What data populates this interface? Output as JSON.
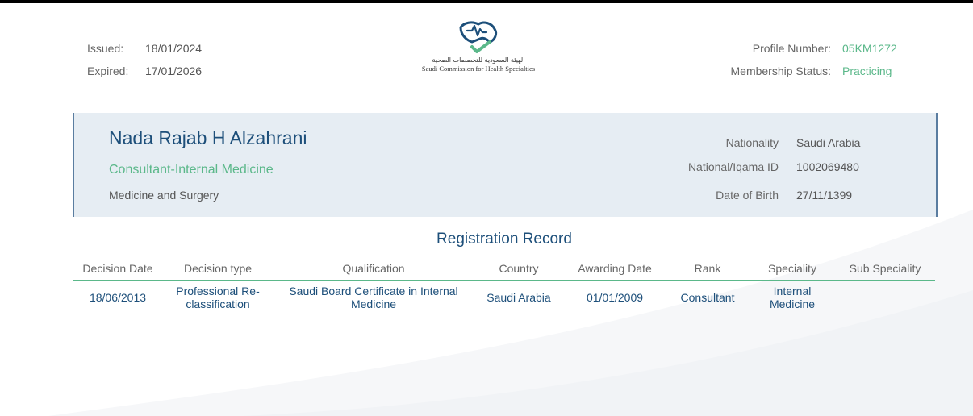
{
  "header": {
    "issued_label": "Issued:",
    "issued_value": "18/01/2024",
    "expired_label": "Expired:",
    "expired_value": "17/01/2026",
    "logo_text_ar": "الهيئة السعودية للتخصصات الصحية",
    "logo_text_en": "Saudi Commission for Health Specialties",
    "profile_number_label": "Profile Number:",
    "profile_number_value": "05KM1272",
    "membership_status_label": "Membership Status:",
    "membership_status_value": "Practicing"
  },
  "profile": {
    "name": "Nada Rajab H Alzahrani",
    "specialty": "Consultant-Internal Medicine",
    "field": "Medicine and Surgery",
    "nationality_label": "Nationality",
    "nationality_value": "Saudi Arabia",
    "national_id_label": "National/Iqama ID",
    "national_id_value": "1002069480",
    "dob_label": "Date of Birth",
    "dob_value": "27/11/1399"
  },
  "registration": {
    "title": "Registration Record",
    "columns": [
      "Decision Date",
      "Decision type",
      "Qualification",
      "Country",
      "Awarding Date",
      "Rank",
      "Speciality",
      "Sub Speciality"
    ],
    "rows": [
      [
        "18/06/2013",
        "Professional Re-classification",
        "Saudi Board Certificate in Internal Medicine",
        "Saudi Arabia",
        "01/01/2009",
        "Consultant",
        "Internal Medicine",
        ""
      ]
    ]
  },
  "colors": {
    "navy": "#1d4f7a",
    "green": "#5bb88a",
    "panel_bg": "#e6edf3"
  }
}
